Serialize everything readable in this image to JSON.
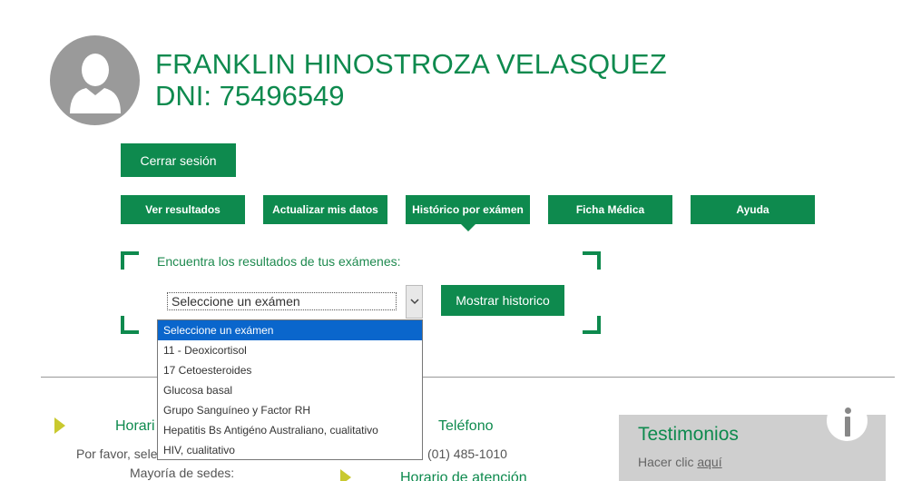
{
  "profile": {
    "name": "FRANKLIN HINOSTROZA VELASQUEZ",
    "dni": "DNI: 75496549"
  },
  "actions": {
    "logout_label": "Cerrar sesión"
  },
  "tabs": [
    {
      "label": "Ver resultados"
    },
    {
      "label": "Actualizar mis datos"
    },
    {
      "label": "Histórico por exámen"
    },
    {
      "label": "Ficha Médica"
    },
    {
      "label": "Ayuda"
    }
  ],
  "active_tab": "Histórico por exámen",
  "search": {
    "prompt": "Encuentra los resultados de tus exámenes:",
    "select_value": "Seleccione un exámen",
    "button_label": "Mostrar historico",
    "options": [
      "Seleccione un exámen",
      "11 - Deoxicortisol",
      "17 Cetoesteroides",
      "Glucosa basal",
      "Grupo Sanguíneo y Factor RH",
      "Hepatitis Bs Antigéno Australiano, cualitativo",
      "HIV, cualitativo"
    ]
  },
  "footer": {
    "horario_heading": "Horari",
    "horario_text": "Por favor, sele",
    "sedes_text": "Mayoría de sedes:",
    "telefono_heading": "Teléfono",
    "telefono_value": "(01) 485-1010",
    "horario_atencion_heading": "Horario de atención"
  },
  "testimonios": {
    "title": "Testimonios",
    "text": "Hacer clic ",
    "link": "aquí"
  },
  "colors": {
    "brand_green": "#0e8a4e",
    "accent_yellow": "#c9c92f",
    "selection_blue": "#0a66cc"
  }
}
